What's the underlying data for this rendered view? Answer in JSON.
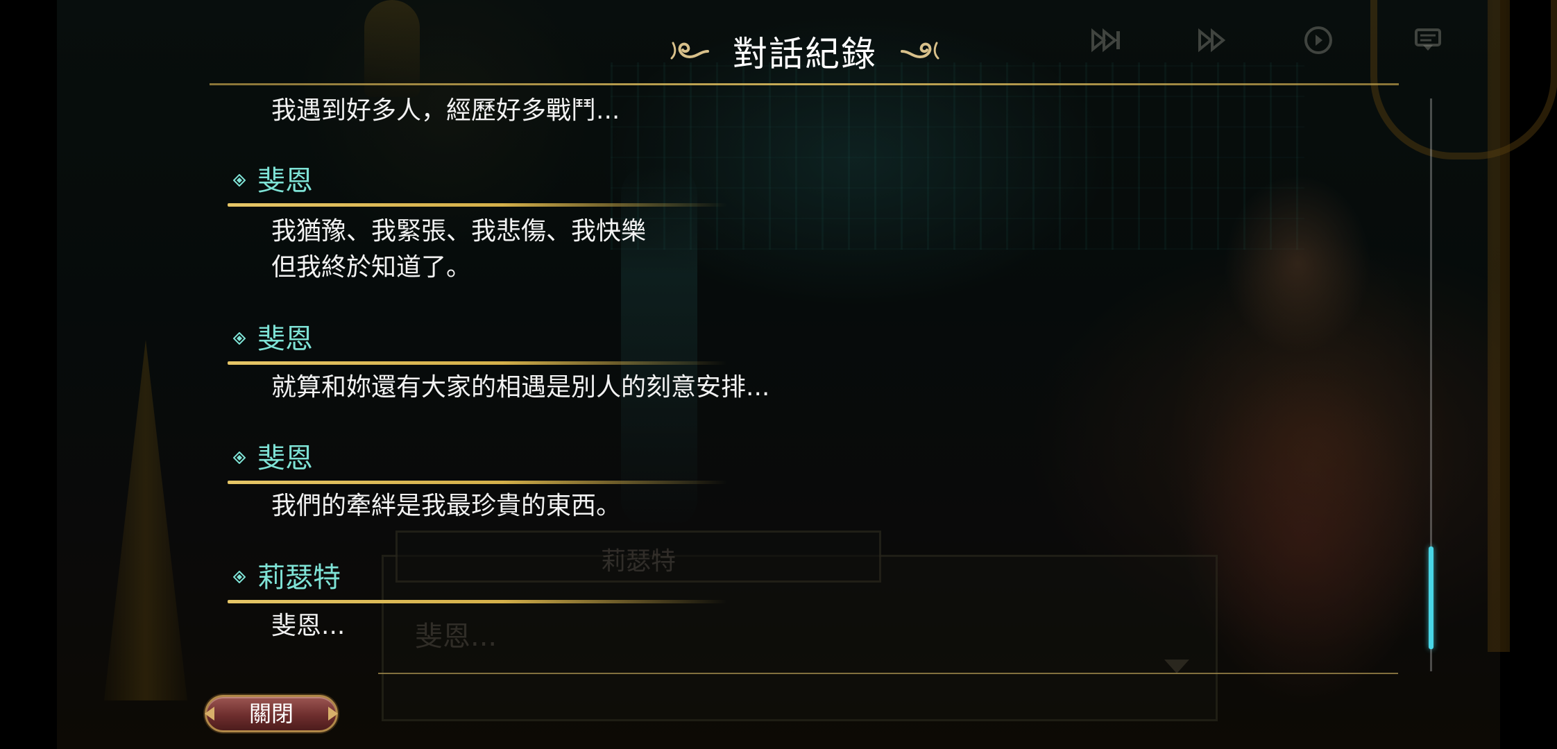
{
  "header": {
    "title": "對話紀錄"
  },
  "background": {
    "dialog_name": "莉瑟特",
    "dialog_text": "斐恩..."
  },
  "top_controls": [
    {
      "icon": "fast-forward-skip-icon"
    },
    {
      "icon": "fast-forward-icon"
    },
    {
      "icon": "auto-play-icon"
    },
    {
      "icon": "log-icon"
    }
  ],
  "log": {
    "entries": [
      {
        "speaker": "",
        "lines": [
          "我遇到好多人，經歷好多戰鬥..."
        ]
      },
      {
        "speaker": "斐恩",
        "lines": [
          "我猶豫、我緊張、我悲傷、我快樂",
          "但我終於知道了。"
        ]
      },
      {
        "speaker": "斐恩",
        "lines": [
          "就算和妳還有大家的相遇是別人的刻意安排..."
        ]
      },
      {
        "speaker": "斐恩",
        "lines": [
          "我們的牽絆是我最珍貴的東西。"
        ]
      },
      {
        "speaker": "莉瑟特",
        "lines": [
          "斐恩..."
        ]
      }
    ]
  },
  "footer": {
    "close_label": "關閉"
  },
  "colors": {
    "speaker_name": "#7fe3d6",
    "underline_gold": "#e6c667",
    "scroll_thumb": "#49d6e6",
    "close_button": "#6e2e2e"
  }
}
